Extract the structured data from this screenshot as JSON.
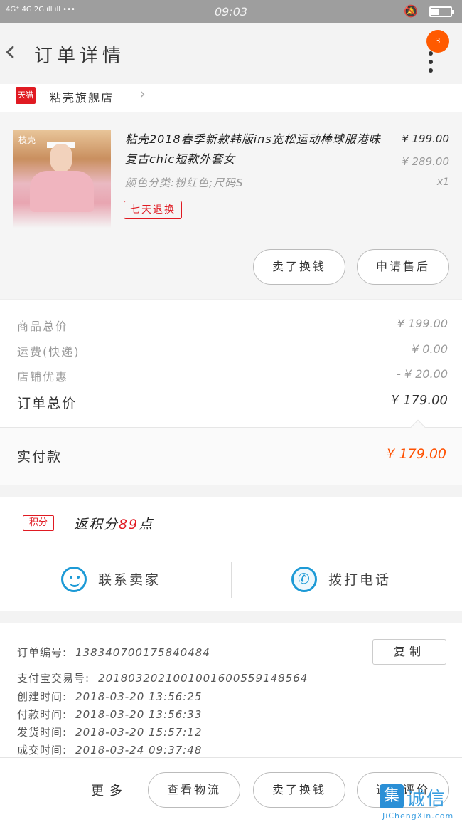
{
  "status_bar": {
    "signal": "4G⁺ 4G 2G ıll ıll •••",
    "time": "09:03"
  },
  "header": {
    "title": "订单详情",
    "notification_count": "3"
  },
  "shop": {
    "platform_badge": "天猫",
    "name": "粘壳旗舰店"
  },
  "product": {
    "image_logo": "枝壳",
    "title": "粘壳2018春季新款韩版ins宽松运动棒球服港味复古chic短款外套女",
    "sku": "颜色分类:粉红色;尺码S",
    "tag": "七天退换",
    "price": "¥ 199.00",
    "original_price": "¥ 289.00",
    "quantity": "x1",
    "buttons": {
      "sell": "卖了换钱",
      "aftersale": "申请售后"
    }
  },
  "totals": {
    "goods_label": "商品总价",
    "goods_value": "¥ 199.00",
    "shipping_label": "运费(快递)",
    "shipping_value": "¥ 0.00",
    "discount_label": "店铺优惠",
    "discount_value": "- ¥ 20.00",
    "order_total_label": "订单总价",
    "order_total_value": "¥ 179.00"
  },
  "payment": {
    "label": "实付款",
    "value": "¥ 179.00"
  },
  "points": {
    "badge": "积分",
    "prefix": "返积分",
    "value": "89",
    "suffix": "点"
  },
  "contact": {
    "seller": "联系卖家",
    "call": "拨打电话"
  },
  "order_info": {
    "order_no_label": "订单编号:",
    "order_no": "138340700175840484",
    "copy": "复制",
    "alipay_label": "支付宝交易号:",
    "alipay_no": "2018032021001001600559148564",
    "created_label": "创建时间:",
    "created": "2018-03-20 13:56:25",
    "paid_label": "付款时间:",
    "paid": "2018-03-20 13:56:33",
    "shipped_label": "发货时间:",
    "shipped": "2018-03-20 15:57:12",
    "completed_label": "成交时间:",
    "completed": "2018-03-24 09:37:48"
  },
  "bottom_bar": {
    "more": "更多",
    "logistics": "查看物流",
    "sell": "卖了换钱",
    "review": "追加评价"
  },
  "watermark": {
    "mark": "集",
    "text": "诚信",
    "url": "JiChengXin.com"
  },
  "colors": {
    "accent_orange": "#ff5000",
    "tmall_red": "#e01a22",
    "contact_blue": "#1d9ad6",
    "notification_badge": "#ff5a00"
  }
}
